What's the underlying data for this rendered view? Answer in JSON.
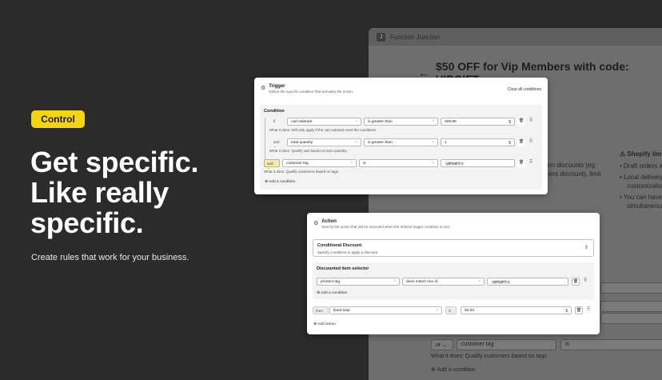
{
  "hero": {
    "badge": "Control",
    "headline": "Get specific. Like really specific.",
    "subtext": "Create rules that work for your business."
  },
  "background_app": {
    "app_name": "Function Junction",
    "page_title": "$50 OFF for Vip Members with code: VIPGIFT",
    "peek_1": "item discounts (eg:",
    "peek_2": "scent discount), limit",
    "limits_title": "Shopify limit",
    "limit_1": "Draft orders a",
    "limit_2": "Local delivery",
    "limit_3": "customization",
    "limit_4": "You can have",
    "limit_5": "simultaneousl",
    "row_keyword": "or",
    "row_field": "customer tag",
    "row_op": "is",
    "row_hint": "What it does: Qualify customers based on tags",
    "add_condition": "Add a condition"
  },
  "trigger": {
    "title": "Trigger",
    "description": "Define the specific condition that activates the action.",
    "clear_all": "Clear all conditions",
    "condition_title": "Condition",
    "rows": [
      {
        "keyword": "if",
        "field": "cart subtotal",
        "operator": "is greater than",
        "value": "499.99",
        "suffix": "$",
        "hint": "What it does: Will only apply if the cart subtotal meet the conditions"
      },
      {
        "keyword": "and",
        "field": "total quantity",
        "operator": "is greater than",
        "value": "1",
        "suffix": "$",
        "hint": "What it does: Qualify cart based on item quantity"
      },
      {
        "keyword": "and",
        "field": "customer tag",
        "operator": "is",
        "value": "VIPGIFT",
        "suffix": "",
        "hint": "What it does: Qualify customers based on tags"
      }
    ],
    "add_condition": "Add a condition"
  },
  "action": {
    "title": "Action",
    "description": "Specify the action that will be executed when the defined trigger condition is met.",
    "dropdown_title": "Conditional Discount",
    "dropdown_desc": "Specify conditions to apply a discount",
    "selector_title": "Discounted item selector",
    "selector_row": {
      "field": "product tag",
      "operator": "does match one of",
      "value": "VIPGIFT"
    },
    "add_condition": "Add a condition",
    "then_keyword": "then",
    "then_field": "fixed total",
    "is_keyword": "is",
    "then_value": "50.00",
    "then_suffix": "$",
    "add_action": "Add action"
  }
}
